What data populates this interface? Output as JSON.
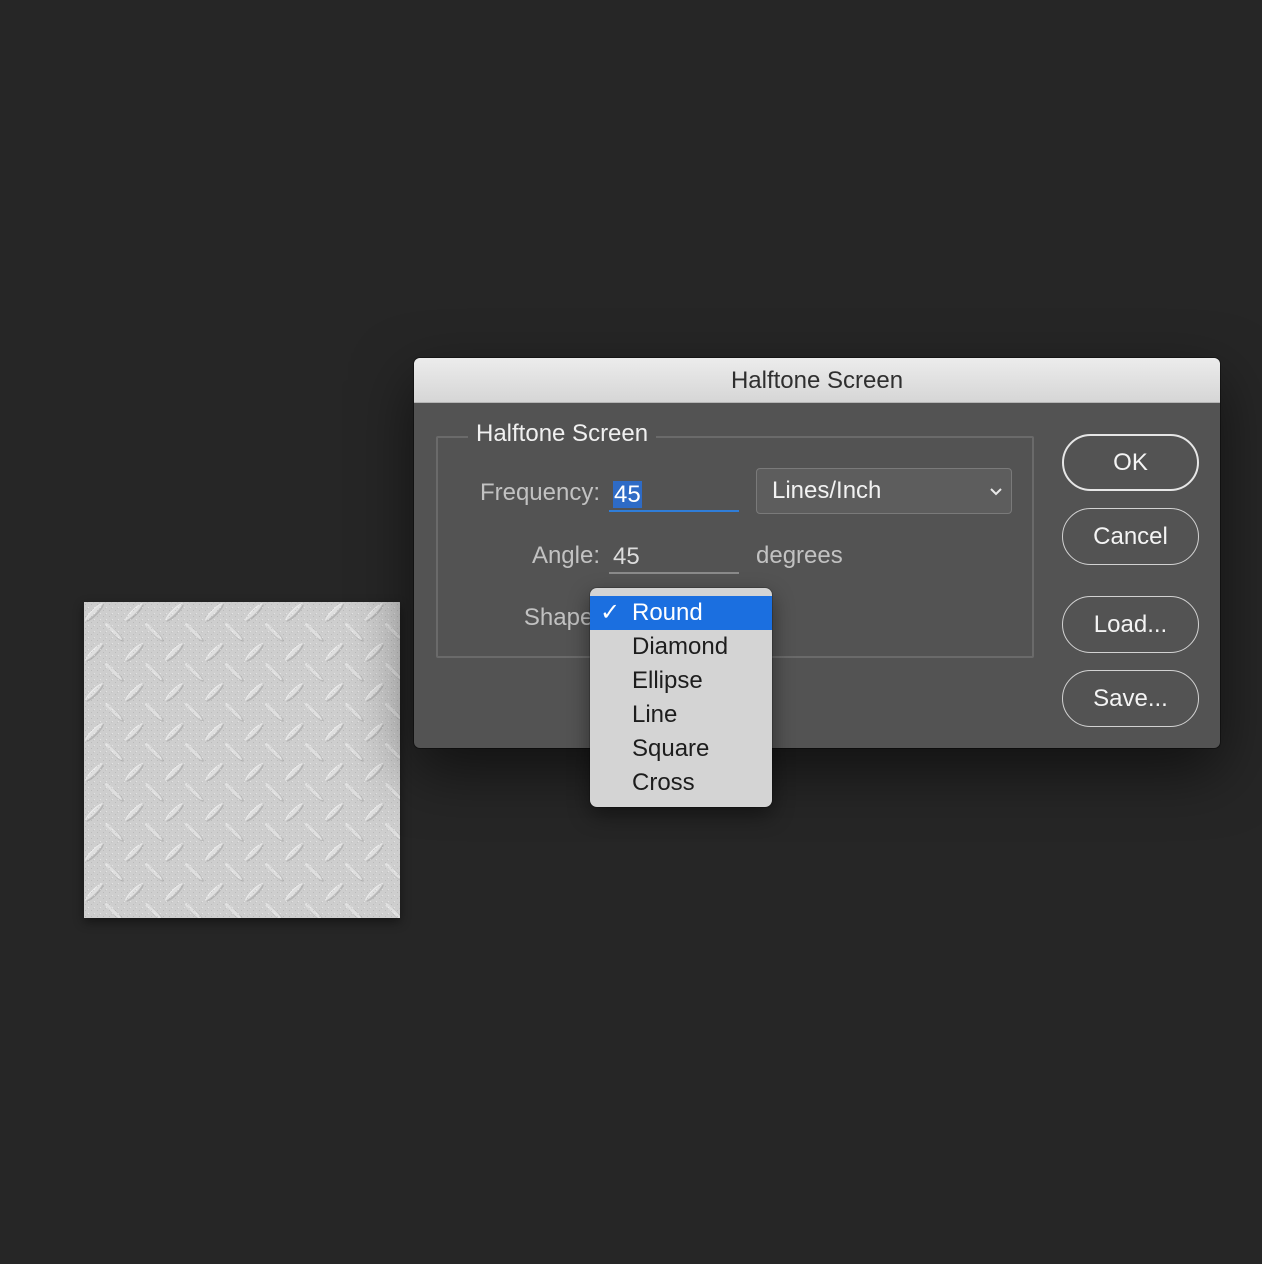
{
  "dialog": {
    "title": "Halftone Screen",
    "group_title": "Halftone Screen",
    "frequency": {
      "label": "Frequency:",
      "value": "45",
      "unit_selected": "Lines/Inch"
    },
    "angle": {
      "label": "Angle:",
      "value": "45",
      "unit": "degrees"
    },
    "shape": {
      "label": "Shape:",
      "options": [
        "Round",
        "Diamond",
        "Ellipse",
        "Line",
        "Square",
        "Cross"
      ],
      "selected": "Round",
      "check_glyph": "✓"
    },
    "buttons": {
      "ok": "OK",
      "cancel": "Cancel",
      "load": "Load...",
      "save": "Save..."
    }
  },
  "colors": {
    "background": "#262626",
    "dialog": "#535353",
    "accent": "#1b6fe0",
    "texture": "#c9c9c9"
  },
  "icons": {
    "select_arrow": "chevron-down-icon",
    "menu_check": "checkmark-icon"
  }
}
